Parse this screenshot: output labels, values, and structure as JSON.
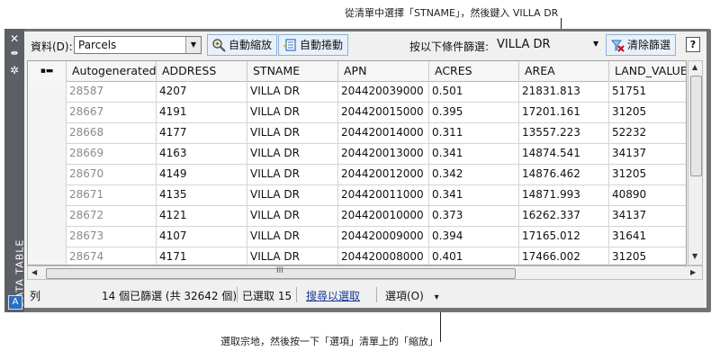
{
  "callouts": {
    "top": "從清單中選擇「STNAME」，然後鍵入 VILLA DR",
    "bottom": "選取宗地，然後按一下「選項」清單上的「縮放」"
  },
  "sidebar": {
    "title": "DATA TABLE",
    "close_glyph": "✕",
    "pin_glyph": "⇹",
    "settings_glyph": "✲",
    "app_glyph": "A"
  },
  "toolbar": {
    "data_label": "資料(D):",
    "data_value": "Parcels",
    "zoom_label": "自動縮放",
    "pan_label": "自動捲動",
    "filter_label": "按以下條件篩選:",
    "filter_value": "VILLA DR",
    "clear_label": "清除篩選",
    "help_label": "?"
  },
  "table": {
    "columns": [
      "Autogenerated_",
      "ADDRESS",
      "STNAME",
      "APN",
      "ACRES",
      "AREA",
      "LAND_VALUE"
    ],
    "rows": [
      [
        "28587",
        "4207",
        "VILLA DR",
        "204420039000",
        "0.501",
        "21831.813",
        "51751"
      ],
      [
        "28667",
        "4191",
        "VILLA DR",
        "204420015000",
        "0.395",
        "17201.161",
        "31205"
      ],
      [
        "28668",
        "4177",
        "VILLA DR",
        "204420014000",
        "0.311",
        "13557.223",
        "52232"
      ],
      [
        "28669",
        "4163",
        "VILLA DR",
        "204420013000",
        "0.341",
        "14874.541",
        "34137"
      ],
      [
        "28670",
        "4149",
        "VILLA DR",
        "204420012000",
        "0.342",
        "14876.462",
        "31205"
      ],
      [
        "28671",
        "4135",
        "VILLA DR",
        "204420011000",
        "0.341",
        "14871.993",
        "40890"
      ],
      [
        "28672",
        "4121",
        "VILLA DR",
        "204420010000",
        "0.373",
        "16262.337",
        "34137"
      ],
      [
        "28673",
        "4107",
        "VILLA DR",
        "204420009000",
        "0.394",
        "17165.012",
        "31641"
      ],
      [
        "28674",
        "4171",
        "VILLA DR",
        "204420008000",
        "0.401",
        "17466.002",
        "31205"
      ]
    ],
    "hscroll_grip": "III"
  },
  "status": {
    "row_label": "列",
    "filtered": "14 個已篩選 (共 32642 個)",
    "selected": "已選取 15",
    "link": "搜尋以選取",
    "options": "選項(O)",
    "options_arrow": "▾"
  },
  "colors": {
    "callout_dot": "#e8001e",
    "panel": "#6f7378",
    "accent": "#2a6ebd"
  }
}
